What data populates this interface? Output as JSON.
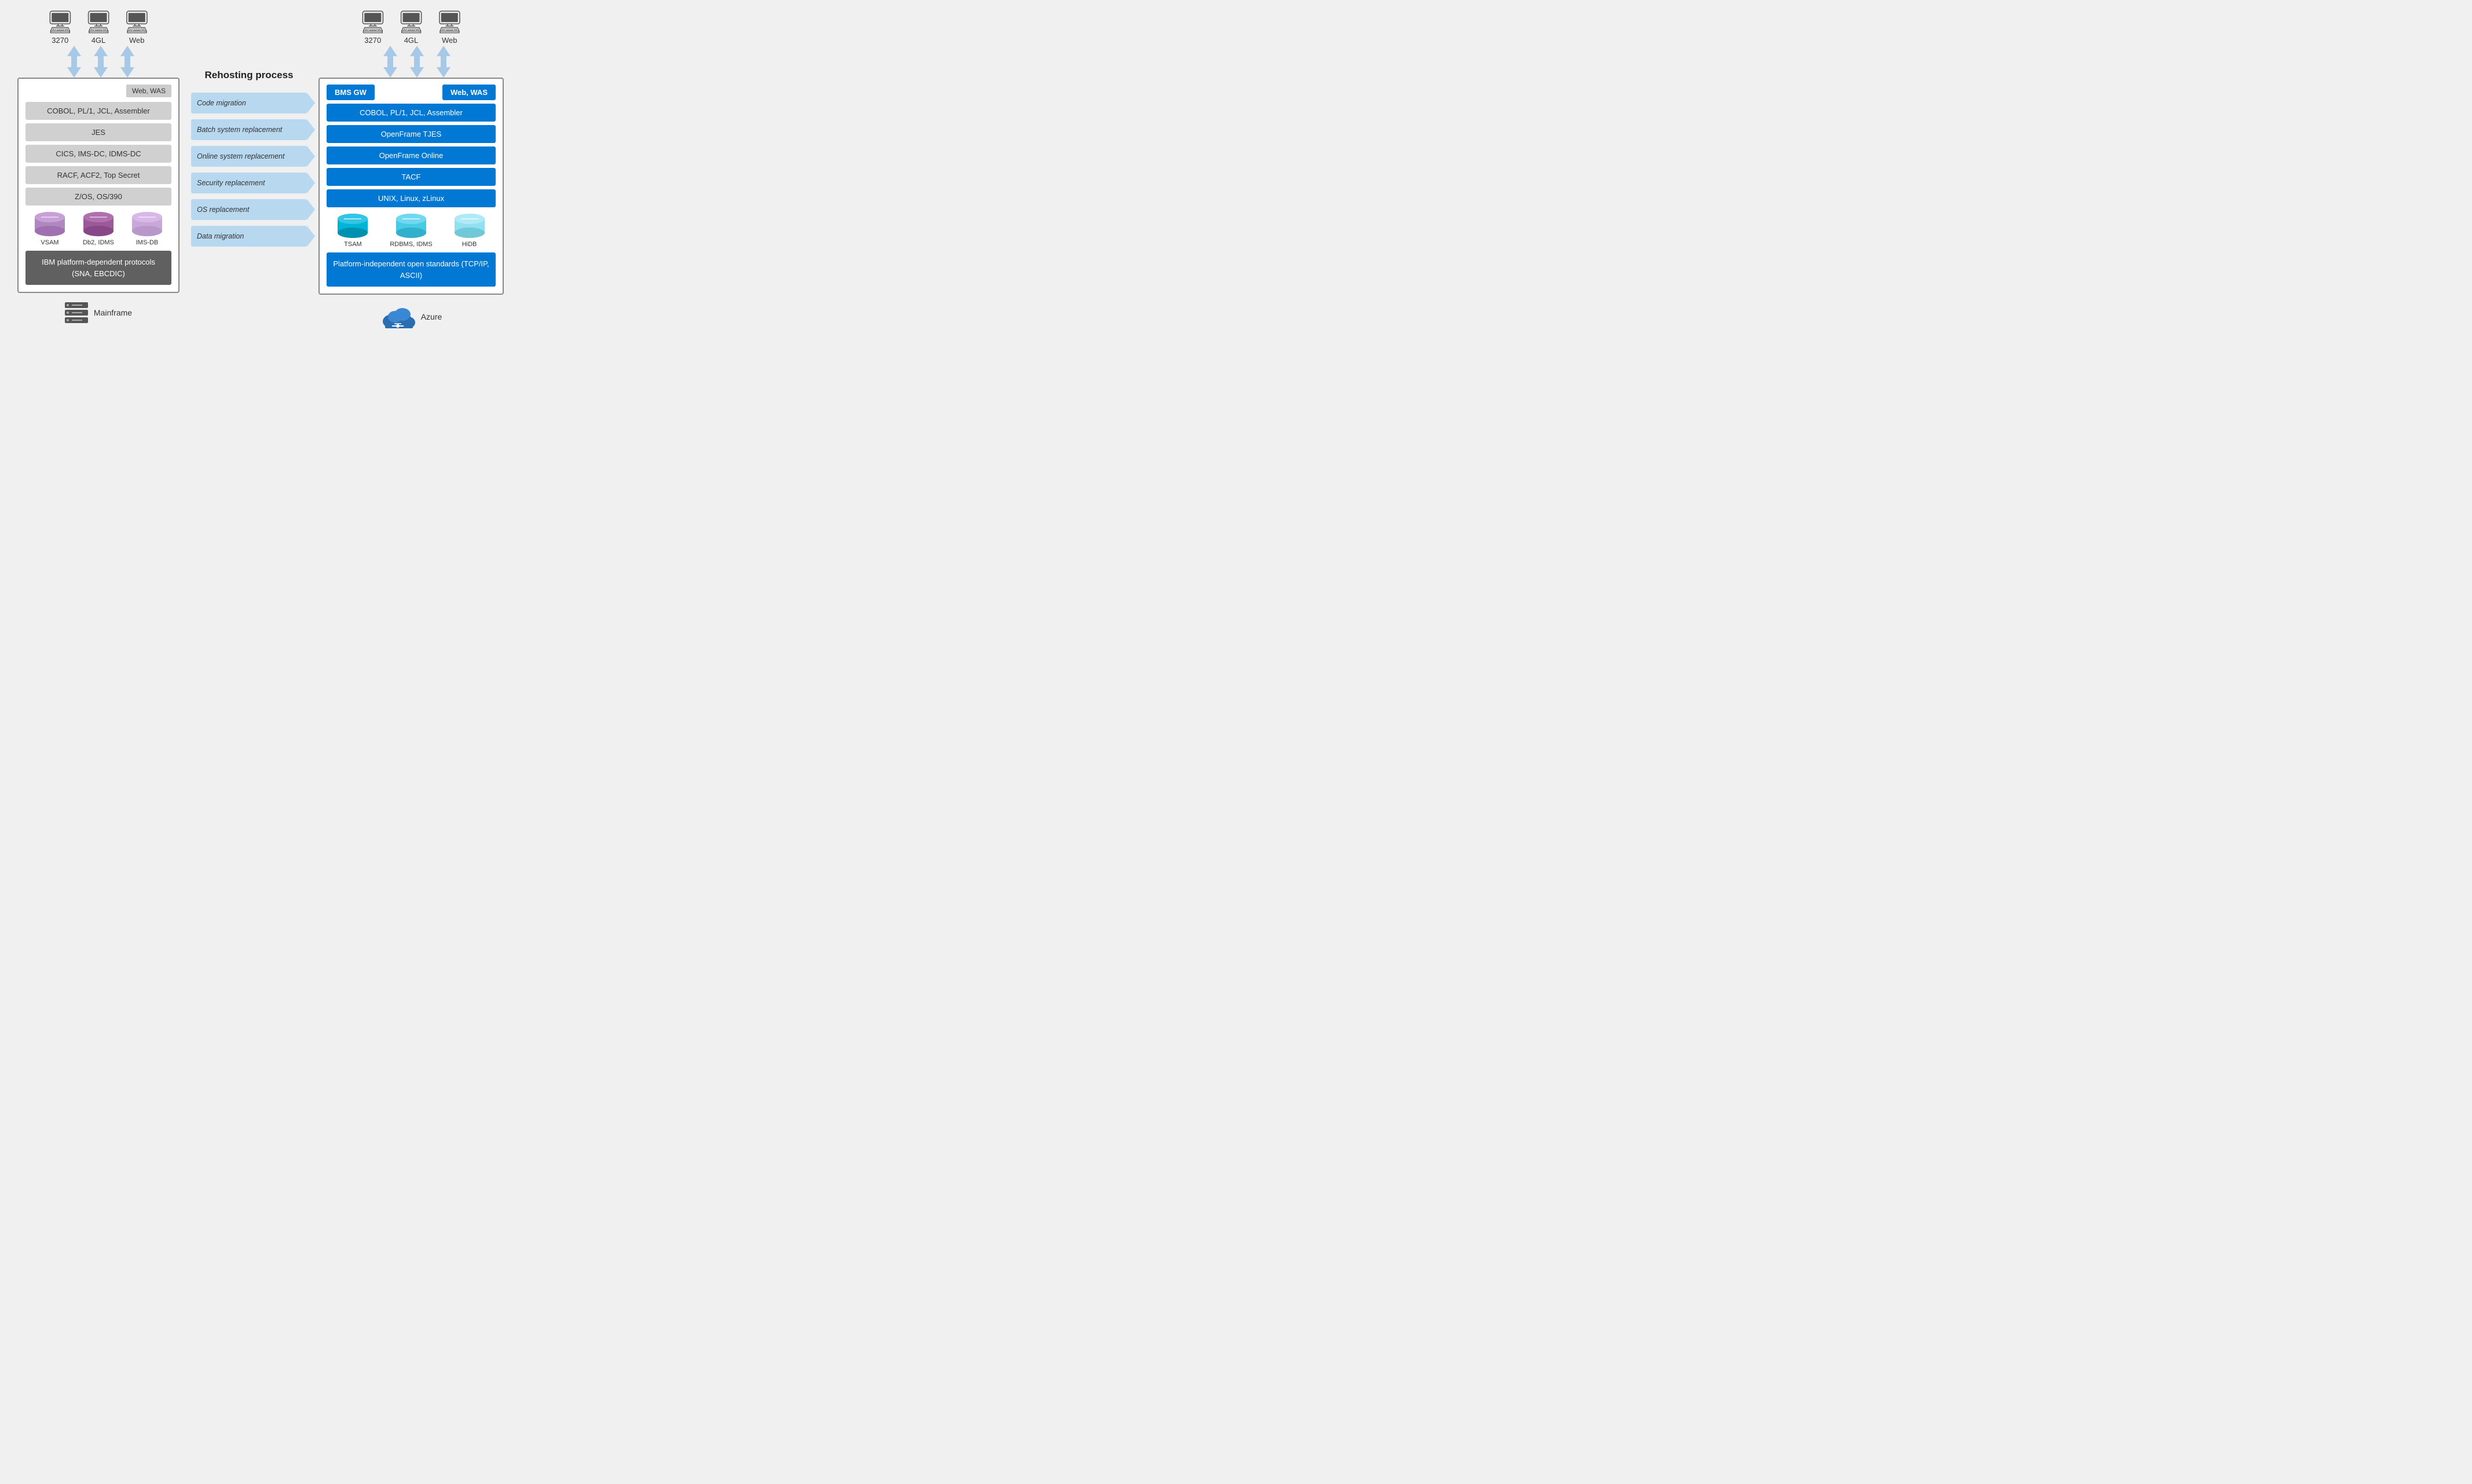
{
  "left": {
    "terminals": [
      {
        "label": "3270"
      },
      {
        "label": "4GL"
      },
      {
        "label": "Web"
      }
    ],
    "web_was_badge": "Web, WAS",
    "rows": [
      {
        "label": "COBOL, PL/1, JCL, Assembler"
      },
      {
        "label": "JES"
      },
      {
        "label": "CICS, IMS-DC, IDMS-DC"
      },
      {
        "label": "RACF, ACF2, Top Secret"
      },
      {
        "label": "Z/OS, OS/390"
      }
    ],
    "databases": [
      {
        "label": "VSAM",
        "color": "#b088c0",
        "top_color": "#c8a0d8"
      },
      {
        "label": "Db2, IDMS",
        "color": "#9a5a9a",
        "top_color": "#b070b0"
      },
      {
        "label": "IMS-DB",
        "color": "#c8a8d8",
        "top_color": "#d8b8e8"
      }
    ],
    "platform_box": "IBM platform-dependent\nprotocols (SNA, EBCDIC)",
    "footer_label": "Mainframe"
  },
  "middle": {
    "title": "Rehosting process",
    "steps": [
      {
        "label": "Code migration"
      },
      {
        "label": "Batch system replacement"
      },
      {
        "label": "Online system replacement"
      },
      {
        "label": "Security replacement"
      },
      {
        "label": "OS replacement"
      },
      {
        "label": "Data migration"
      }
    ]
  },
  "right": {
    "terminals": [
      {
        "label": "3270"
      },
      {
        "label": "4GL"
      },
      {
        "label": "Web"
      }
    ],
    "bms_gw": "BMS GW",
    "web_was": "Web, WAS",
    "rows": [
      {
        "label": "COBOL, PL/1, JCL, Assembler"
      },
      {
        "label": "OpenFrame TJES"
      },
      {
        "label": "OpenFrame Online"
      },
      {
        "label": "TACF"
      },
      {
        "label": "UNIX, Linux, zLinux"
      }
    ],
    "databases": [
      {
        "label": "TSAM",
        "color": "#00b4d8",
        "top_color": "#33c5e4"
      },
      {
        "label": "RDBMS, IDMS",
        "color": "#48cae4",
        "top_color": "#70d8f0"
      },
      {
        "label": "HiDB",
        "color": "#90e0ef",
        "top_color": "#aeeaf7"
      }
    ],
    "platform_box": "Platform-independent\nopen standards (TCP/IP, ASCII)",
    "footer_label": "Azure"
  }
}
